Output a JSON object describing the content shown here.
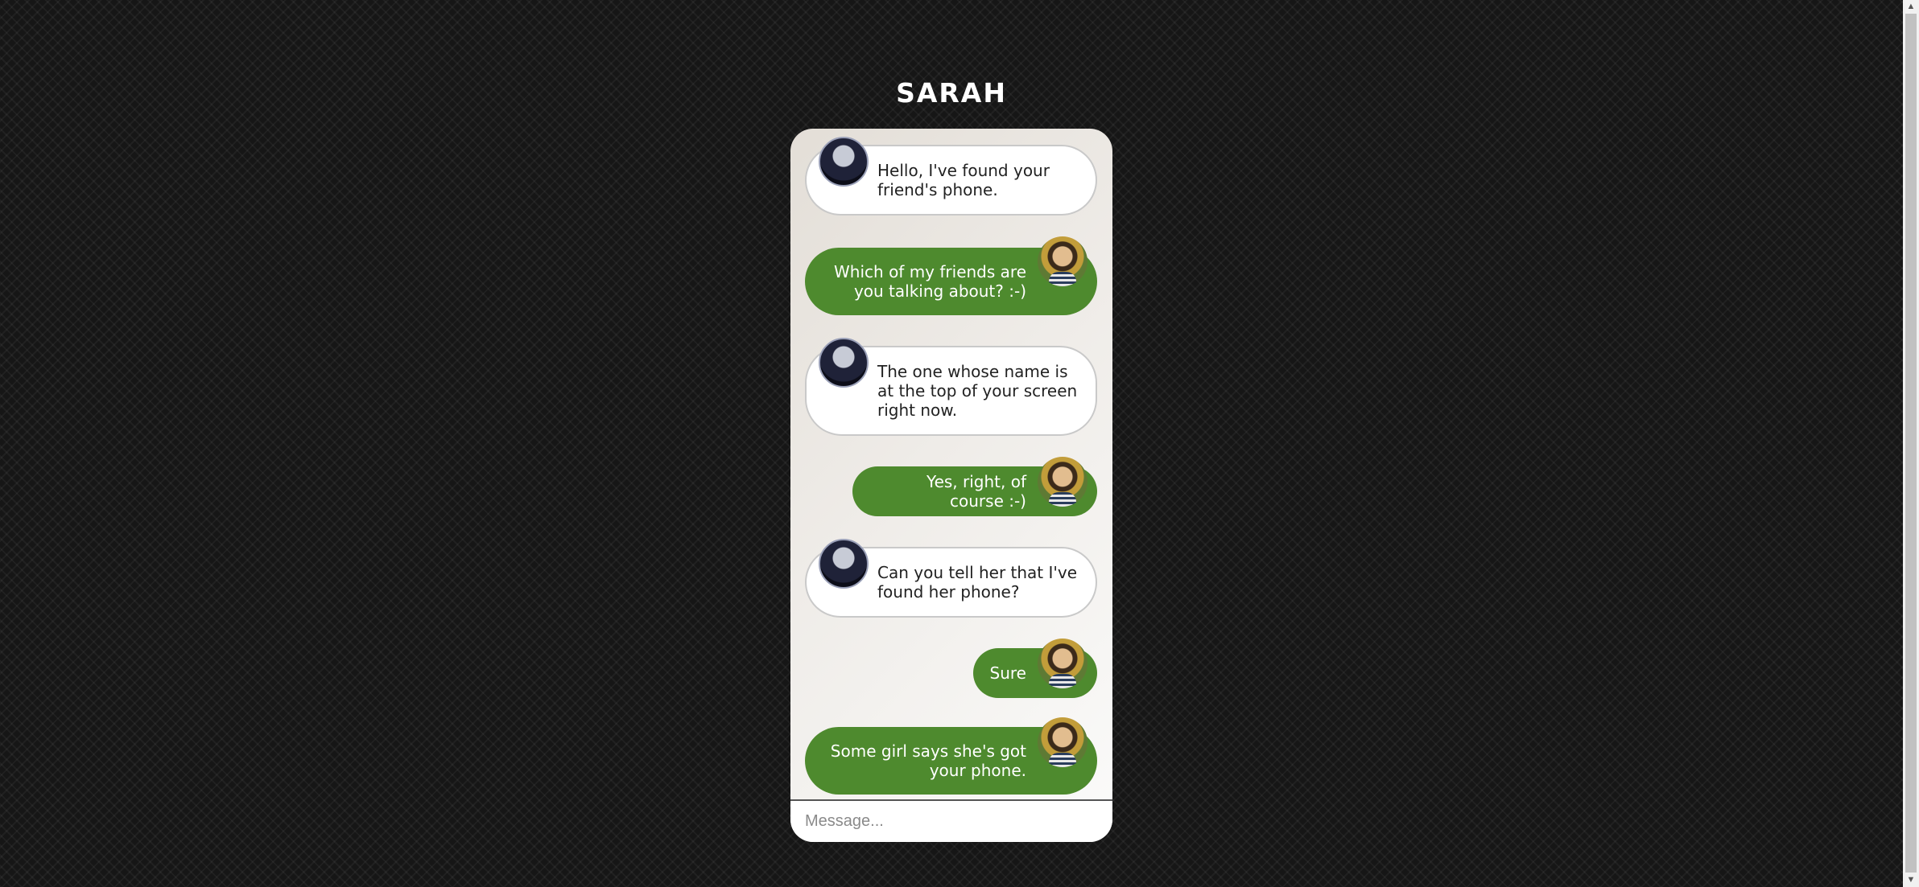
{
  "header": {
    "title": "SARAH"
  },
  "messages": [
    {
      "direction": "in",
      "text": "Hello, I've found your friend's phone."
    },
    {
      "direction": "out",
      "text": "Which of my friends are you talking about? :-)"
    },
    {
      "direction": "in",
      "text": "The one whose name is at the top of your screen right now."
    },
    {
      "direction": "out",
      "text": "Yes, right, of course :-)"
    },
    {
      "direction": "in",
      "text": "Can you tell her that I've found her phone?"
    },
    {
      "direction": "out",
      "text": "Sure"
    },
    {
      "direction": "out",
      "text": "Some girl says she's got your phone."
    }
  ],
  "composer": {
    "placeholder": "Message..."
  },
  "colors": {
    "outgoing_bubble": "#4e8a2e",
    "incoming_bubble": "#ffffff"
  }
}
